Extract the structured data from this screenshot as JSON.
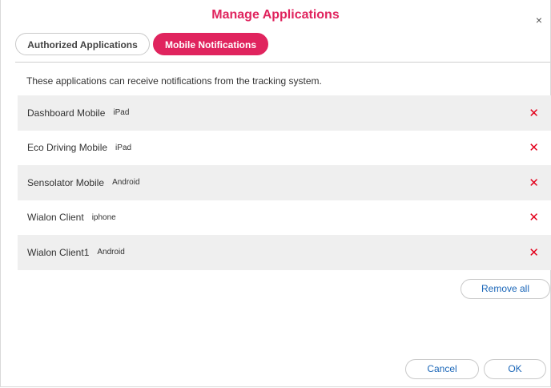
{
  "dialog": {
    "title": "Manage Applications",
    "close_icon": "×"
  },
  "tabs": [
    {
      "label": "Authorized Applications",
      "active": false
    },
    {
      "label": "Mobile Notifications",
      "active": true
    }
  ],
  "description": "These applications can receive notifications from the tracking system.",
  "applications": [
    {
      "name": "Dashboard Mobile",
      "platform": "iPad"
    },
    {
      "name": "Eco Driving Mobile",
      "platform": "iPad"
    },
    {
      "name": "Sensolator Mobile",
      "platform": "Android"
    },
    {
      "name": "Wialon Client",
      "platform": "iphone"
    },
    {
      "name": "Wialon Client1",
      "platform": "Android"
    }
  ],
  "delete_icon": "✕",
  "buttons": {
    "remove_all": "Remove all",
    "cancel": "Cancel",
    "ok": "OK"
  },
  "colors": {
    "accent": "#e0245e",
    "delete": "#e3001b",
    "link": "#1a66b8",
    "row_alt": "#efefef"
  }
}
